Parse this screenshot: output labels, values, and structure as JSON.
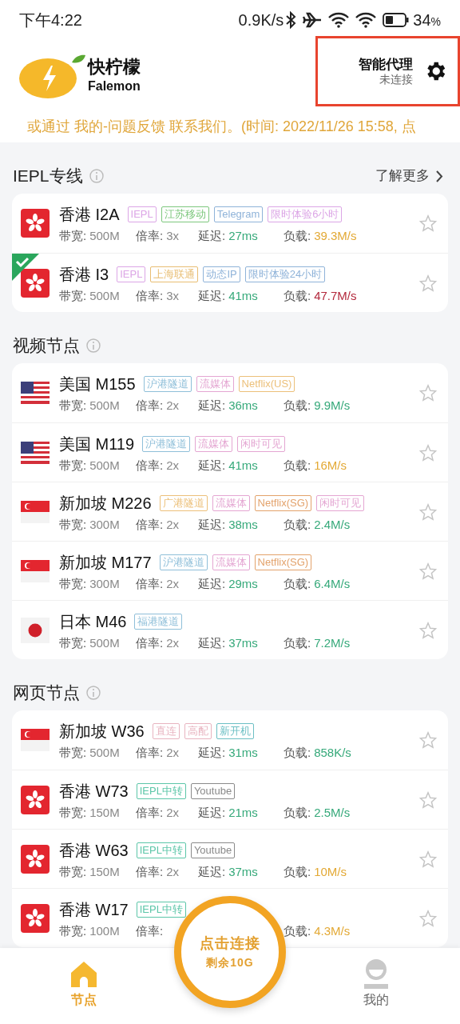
{
  "status_bar": {
    "time": "下午4:22",
    "net_speed": "0.9K/s",
    "battery": "34",
    "battery_unit": "%"
  },
  "header": {
    "app_name": "快柠檬",
    "app_subtitle": "Falemon",
    "proxy": {
      "mode": "智能代理",
      "status": "未连接",
      "highlighted": true
    }
  },
  "notice": "或通过 我的-问题反馈 联系我们。(时间: 2022/11/26 15:58, 点",
  "sections": [
    {
      "title": "IEPL专线",
      "more_link": "了解更多",
      "nodes": [
        {
          "kind": "hk",
          "name": "香港 I2A",
          "selected": false,
          "starred": false,
          "tags": [
            {
              "text": "IEPL",
              "color": "#dca6e6"
            },
            {
              "text": "江苏移动",
              "color": "#7dc77d"
            },
            {
              "text": "Telegram",
              "color": "#8fb3d9"
            },
            {
              "text": "限时体验6小时",
              "color": "#dca6e6"
            }
          ],
          "stats": [
            {
              "label": "带宽:",
              "value": "500M"
            },
            {
              "label": "倍率:",
              "value": "3x"
            },
            {
              "label": "延迟:",
              "value": "27ms",
              "color": "#36a97a"
            },
            {
              "label": "负载:",
              "value": "39.3M/s",
              "color": "#e3a935"
            }
          ]
        },
        {
          "kind": "hk",
          "name": "香港 I3",
          "selected": true,
          "starred": false,
          "tags": [
            {
              "text": "IEPL",
              "color": "#dca6e6"
            },
            {
              "text": "上海联通",
              "color": "#e8bd72"
            },
            {
              "text": "动态IP",
              "color": "#8fb3d9"
            },
            {
              "text": "限时体验24小时",
              "color": "#8fb3d9"
            }
          ],
          "stats": [
            {
              "label": "带宽:",
              "value": "500M"
            },
            {
              "label": "倍率:",
              "value": "3x"
            },
            {
              "label": "延迟:",
              "value": "41ms",
              "color": "#36a97a"
            },
            {
              "label": "负载:",
              "value": "47.7M/s",
              "color": "#b3283c"
            }
          ]
        }
      ]
    },
    {
      "title": "视频节点",
      "nodes": [
        {
          "kind": "us",
          "name": "美国 M155",
          "selected": false,
          "starred": false,
          "tags": [
            {
              "text": "沪港隧道",
              "color": "#8fbfd9"
            },
            {
              "text": "流媒体",
              "color": "#e4a6d2"
            },
            {
              "text": "Netflix(US)",
              "color": "#ecc07a"
            }
          ],
          "stats": [
            {
              "label": "带宽:",
              "value": "500M"
            },
            {
              "label": "倍率:",
              "value": "2x"
            },
            {
              "label": "延迟:",
              "value": "36ms",
              "color": "#36a97a"
            },
            {
              "label": "负载:",
              "value": "9.9M/s",
              "color": "#36a97a"
            }
          ]
        },
        {
          "kind": "us",
          "name": "美国 M119",
          "selected": false,
          "starred": false,
          "tags": [
            {
              "text": "沪港隧道",
              "color": "#8fbfd9"
            },
            {
              "text": "流媒体",
              "color": "#e4a6d2"
            },
            {
              "text": "闲时可见",
              "color": "#e4a6d2"
            }
          ],
          "stats": [
            {
              "label": "带宽:",
              "value": "500M"
            },
            {
              "label": "倍率:",
              "value": "2x"
            },
            {
              "label": "延迟:",
              "value": "41ms",
              "color": "#36a97a"
            },
            {
              "label": "负载:",
              "value": "16M/s",
              "color": "#e3a935"
            }
          ]
        },
        {
          "kind": "sg",
          "name": "新加坡 M226",
          "selected": false,
          "starred": false,
          "tags": [
            {
              "text": "广港隧道",
              "color": "#ecc07a"
            },
            {
              "text": "流媒体",
              "color": "#e4a6d2"
            },
            {
              "text": "Netflix(SG)",
              "color": "#e3a26b"
            },
            {
              "text": "闲时可见",
              "color": "#e4a6d2"
            }
          ],
          "stats": [
            {
              "label": "带宽:",
              "value": "300M"
            },
            {
              "label": "倍率:",
              "value": "2x"
            },
            {
              "label": "延迟:",
              "value": "38ms",
              "color": "#36a97a"
            },
            {
              "label": "负载:",
              "value": "2.4M/s",
              "color": "#36a97a"
            }
          ]
        },
        {
          "kind": "sg",
          "name": "新加坡 M177",
          "selected": false,
          "starred": false,
          "tags": [
            {
              "text": "沪港隧道",
              "color": "#8fbfd9"
            },
            {
              "text": "流媒体",
              "color": "#e4a6d2"
            },
            {
              "text": "Netflix(SG)",
              "color": "#e3a26b"
            }
          ],
          "stats": [
            {
              "label": "带宽:",
              "value": "300M"
            },
            {
              "label": "倍率:",
              "value": "2x"
            },
            {
              "label": "延迟:",
              "value": "29ms",
              "color": "#36a97a"
            },
            {
              "label": "负载:",
              "value": "6.4M/s",
              "color": "#36a97a"
            }
          ]
        },
        {
          "kind": "jp",
          "name": "日本 M46",
          "selected": false,
          "starred": false,
          "tags": [
            {
              "text": "福港隧道",
              "color": "#8fbfd9"
            }
          ],
          "stats": [
            {
              "label": "带宽:",
              "value": "500M"
            },
            {
              "label": "倍率:",
              "value": "2x"
            },
            {
              "label": "延迟:",
              "value": "37ms",
              "color": "#36a97a"
            },
            {
              "label": "负载:",
              "value": "7.2M/s",
              "color": "#36a97a"
            }
          ]
        }
      ]
    },
    {
      "title": "网页节点",
      "nodes": [
        {
          "kind": "sg",
          "name": "新加坡 W36",
          "selected": false,
          "starred": false,
          "tags": [
            {
              "text": "直连",
              "color": "#e8b4c0"
            },
            {
              "text": "高配",
              "color": "#e8b4c0"
            },
            {
              "text": "新开机",
              "color": "#6cbfc4"
            }
          ],
          "stats": [
            {
              "label": "带宽:",
              "value": "500M"
            },
            {
              "label": "倍率:",
              "value": "2x"
            },
            {
              "label": "延迟:",
              "value": "31ms",
              "color": "#36a97a"
            },
            {
              "label": "负载:",
              "value": "858K/s",
              "color": "#36a97a"
            }
          ]
        },
        {
          "kind": "hk",
          "name": "香港 W73",
          "selected": false,
          "starred": false,
          "tags": [
            {
              "text": "IEPL中转",
              "color": "#5cc6a8"
            },
            {
              "text": "Youtube",
              "color": "#8a8a8a"
            }
          ],
          "stats": [
            {
              "label": "带宽:",
              "value": "150M"
            },
            {
              "label": "倍率:",
              "value": "2x"
            },
            {
              "label": "延迟:",
              "value": "21ms",
              "color": "#36a97a"
            },
            {
              "label": "负载:",
              "value": "2.5M/s",
              "color": "#36a97a"
            }
          ]
        },
        {
          "kind": "hk",
          "name": "香港 W63",
          "selected": false,
          "starred": false,
          "tags": [
            {
              "text": "IEPL中转",
              "color": "#5cc6a8"
            },
            {
              "text": "Youtube",
              "color": "#8a8a8a"
            }
          ],
          "stats": [
            {
              "label": "带宽:",
              "value": "150M"
            },
            {
              "label": "倍率:",
              "value": "2x"
            },
            {
              "label": "延迟:",
              "value": "37ms",
              "color": "#36a97a"
            },
            {
              "label": "负载:",
              "value": "10M/s",
              "color": "#e3a935"
            }
          ]
        },
        {
          "kind": "hk",
          "name": "香港 W17",
          "selected": false,
          "starred": false,
          "tags": [
            {
              "text": "IEPL中转",
              "color": "#5cc6a8"
            }
          ],
          "stats": [
            {
              "label": "带宽:",
              "value": "100M"
            },
            {
              "label": "倍率:"
            },
            {
              "label": "负载:",
              "value": "4.3M/s",
              "color": "#e3a935",
              "kind": "load"
            }
          ]
        }
      ]
    }
  ],
  "connect_button": {
    "label": "点击连接",
    "remaining": "剩余10G"
  },
  "tabs": [
    {
      "label": "节点",
      "selected": true
    },
    {
      "label": "我的",
      "selected": false
    }
  ]
}
